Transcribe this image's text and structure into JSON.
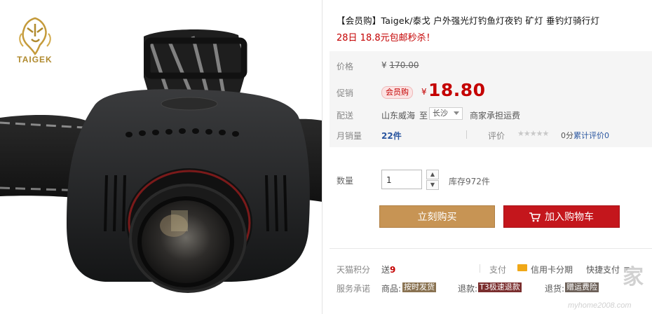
{
  "product": {
    "title": "【会员购】Taigek/泰戈 户外强光灯钓鱼灯夜钓 矿灯 垂钓灯骑行灯",
    "promo_text": "28日 18.8元包邮秒杀！",
    "brand_logo_text": "TAIGEK"
  },
  "price": {
    "label": "价格",
    "original": "170.00",
    "currency_symbol": "¥"
  },
  "promotion": {
    "label": "促销",
    "badge": "会员购",
    "price": "18.80"
  },
  "delivery": {
    "label": "配送",
    "origin": "山东威海",
    "to": "至",
    "destination": "长沙",
    "fee_note": "商家承担运费"
  },
  "sales": {
    "label": "月销量",
    "value": "22件",
    "rating_label": "评价",
    "rating_stars": "★★★★★",
    "rating_score": "0分",
    "review_label": "累计评价",
    "review_count": "0"
  },
  "quantity": {
    "label": "数量",
    "value": "1",
    "stock": "库存972件"
  },
  "actions": {
    "buy_now": "立刻购买",
    "add_to_cart": "加入购物车"
  },
  "points": {
    "label": "天猫积分",
    "prefix": "送",
    "value": "9"
  },
  "payment": {
    "label": "支付",
    "credit_card": "信用卡分期",
    "quick_pay": "快捷支付"
  },
  "service": {
    "label": "服务承诺",
    "items": [
      {
        "prefix": "商品:",
        "badge": "按时发货"
      },
      {
        "prefix": "退款:",
        "badge": "T3极速退款"
      },
      {
        "prefix": "退货:",
        "badge": "赠运费险"
      }
    ]
  },
  "watermark": {
    "brand": "家",
    "url": "myhome2008.com"
  },
  "colors": {
    "accent_red": "#c40000",
    "buy_button": "#c79454",
    "cart_button": "#c4161c",
    "logo_gold": "#b08a2e"
  },
  "icons": [
    "tiger-logo-icon",
    "dropdown-arrow-icon",
    "star-icon",
    "cart-icon",
    "credit-card-icon",
    "chevron-down-icon",
    "spinner-up-icon",
    "spinner-down-icon"
  ]
}
